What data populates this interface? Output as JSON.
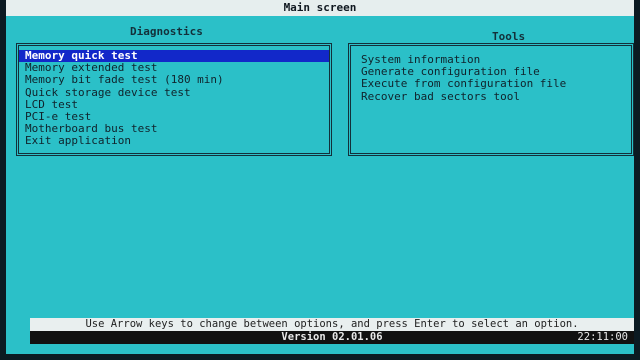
{
  "window": {
    "title": "Main screen"
  },
  "diagnostics": {
    "title": "Diagnostics",
    "items": [
      {
        "label": "Memory quick test",
        "selected": true
      },
      {
        "label": "Memory extended test",
        "selected": false
      },
      {
        "label": "Memory bit fade test (180 min)",
        "selected": false
      },
      {
        "label": "Quick storage device test",
        "selected": false
      },
      {
        "label": "LCD test",
        "selected": false
      },
      {
        "label": "PCI-e test",
        "selected": false
      },
      {
        "label": "Motherboard bus test",
        "selected": false
      },
      {
        "label": "Exit application",
        "selected": false
      }
    ]
  },
  "tools": {
    "title": "Tools",
    "items": [
      {
        "label": "System information"
      },
      {
        "label": "Generate configuration file"
      },
      {
        "label": "Execute from configuration file"
      },
      {
        "label": "Recover bad sectors tool"
      }
    ]
  },
  "footer": {
    "hint": "Use Arrow keys to change between options, and press Enter to select an option.",
    "version": "Version 02.01.06",
    "clock": "22:11:00"
  },
  "colors": {
    "background": "#2bc0c8",
    "selection": "#1228c9",
    "titlebar": "#e6eeee",
    "statusbar": "#111111"
  }
}
